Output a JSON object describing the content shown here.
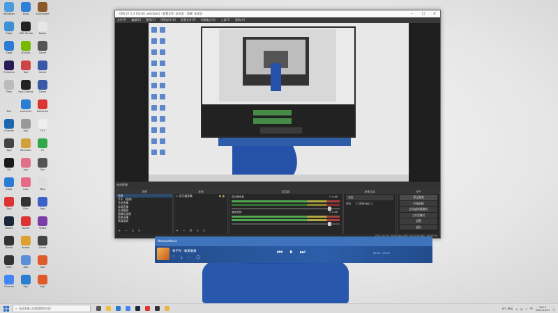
{
  "desktop": {
    "icons": [
      {
        "label": "Windows",
        "color": "#4a9be0"
      },
      {
        "label": "Bing",
        "color": "#2f7fd8"
      },
      {
        "label": "Soundlight",
        "color": "#8b5a2b"
      },
      {
        "label": "Edge",
        "color": "#3d8fd6"
      },
      {
        "label": "OBS Studio",
        "color": "#222"
      },
      {
        "label": "Notes",
        "color": "#e7e7e7"
      },
      {
        "label": "Edge",
        "color": "#2b7cd3"
      },
      {
        "label": "NVIDIA",
        "color": "#76b900"
      },
      {
        "label": "Game",
        "color": "#555"
      },
      {
        "label": "Premiere",
        "color": "#2a1a55"
      },
      {
        "label": "Tool",
        "color": "#c44"
      },
      {
        "label": "Game",
        "color": "#3a58a8"
      },
      {
        "label": "Files",
        "color": "#bbb"
      },
      {
        "label": "Epic Games",
        "color": "#222"
      },
      {
        "label": "Game",
        "color": "#3a58a8"
      },
      {
        "label": "Doc",
        "color": "#ddd"
      },
      {
        "label": "Launcher",
        "color": "#2b7cd3"
      },
      {
        "label": "Kuaishou",
        "color": "#d33"
      },
      {
        "label": "Chrome",
        "color": "#1c66b0"
      },
      {
        "label": "App",
        "color": "#999"
      },
      {
        "label": "TXT",
        "color": "#eee"
      },
      {
        "label": "App",
        "color": "#444"
      },
      {
        "label": "Recorder",
        "color": "#d2a03a"
      },
      {
        "label": "Hi",
        "color": "#2fa84a"
      },
      {
        "label": "QQ",
        "color": "#1a1a1a"
      },
      {
        "label": "App",
        "color": "#e0708a"
      },
      {
        "label": "Tool",
        "color": "#555"
      },
      {
        "label": "Edge",
        "color": "#2b7cd3"
      },
      {
        "label": "Lala",
        "color": "#e56a8a"
      },
      {
        "label": "Map",
        "color": "#ddd"
      },
      {
        "label": "App",
        "color": "#d33"
      },
      {
        "label": "Disc",
        "color": "#333"
      },
      {
        "label": "App",
        "color": "#3b62c6"
      },
      {
        "label": "Steam",
        "color": "#1b2838"
      },
      {
        "label": "Game",
        "color": "#d33"
      },
      {
        "label": "Video",
        "color": "#7a3da8"
      },
      {
        "label": "Game",
        "color": "#333"
      },
      {
        "label": "Avatar",
        "color": "#e0a030"
      },
      {
        "label": "Game",
        "color": "#444"
      },
      {
        "label": "Disc",
        "color": "#333"
      },
      {
        "label": "App",
        "color": "#5a8fd8"
      },
      {
        "label": "App",
        "color": "#e05a2a"
      },
      {
        "label": "Chrome",
        "color": "#4285f4"
      },
      {
        "label": "App",
        "color": "#2b7cd3"
      },
      {
        "label": "App",
        "color": "#e05a2a"
      }
    ]
  },
  "obs": {
    "window_title": "OBS 27.1.3 (64-bit, windows) - 配置文件: 未命名 - 场景: 未命名",
    "menu": [
      "文件(F)",
      "编辑(E)",
      "视图(V)",
      "停靠部件(D)",
      "配置文件(P)",
      "场景集合(S)",
      "工具(T)",
      "帮助(H)"
    ],
    "dock_header_label": "未选择源",
    "docks": {
      "scenes": {
        "title": "场景",
        "items": [
          "场景",
          "片头（图像）",
          "开始直播",
          "屏幕直播",
          "在线歌曲",
          "摄像机录制",
          "结束直播",
          "高清录屏"
        ]
      },
      "sources": {
        "title": "来源",
        "items": [
          "显示器采集"
        ]
      },
      "mixer": {
        "title": "混音器",
        "channels": [
          {
            "name": "显示器采集",
            "db": "0.0 dB"
          },
          {
            "name": "桌面音频",
            "db": "0.0 dB"
          }
        ]
      },
      "transitions": {
        "title": "场景过渡",
        "type": "淡出",
        "duration_label": "时长",
        "duration": "300 ms"
      },
      "controls": {
        "title": "控件",
        "buttons": [
          "停止推流",
          "开始录制",
          "启动虚拟摄像机",
          "工作室模式",
          "设置",
          "退出"
        ]
      }
    },
    "status": "CPU: 15.1%, 30.00 fps   LIVE: 00:12:34   REC: 00:00:00"
  },
  "player": {
    "app_name": "NeteaseMusic",
    "song": "林子祥 - 敢爱敢做",
    "time": "00:52 / 03:47",
    "controls": [
      "⏮",
      "⏸",
      "⏭"
    ]
  },
  "taskbar": {
    "search_placeholder": "在这里输入你要搜索的内容",
    "apps": [
      {
        "name": "task-view",
        "color": "#555"
      },
      {
        "name": "file-explorer",
        "color": "#f0c040"
      },
      {
        "name": "edge",
        "color": "#2b7cd3"
      },
      {
        "name": "chrome",
        "color": "#4285f4"
      },
      {
        "name": "steam",
        "color": "#1b2838"
      },
      {
        "name": "netease",
        "color": "#d33"
      },
      {
        "name": "obs",
        "color": "#333"
      },
      {
        "name": "folder",
        "color": "#e8b84a"
      }
    ],
    "weather": "8°C 多云",
    "lang": "中",
    "time": "16:13",
    "date": "2021/12/27"
  }
}
